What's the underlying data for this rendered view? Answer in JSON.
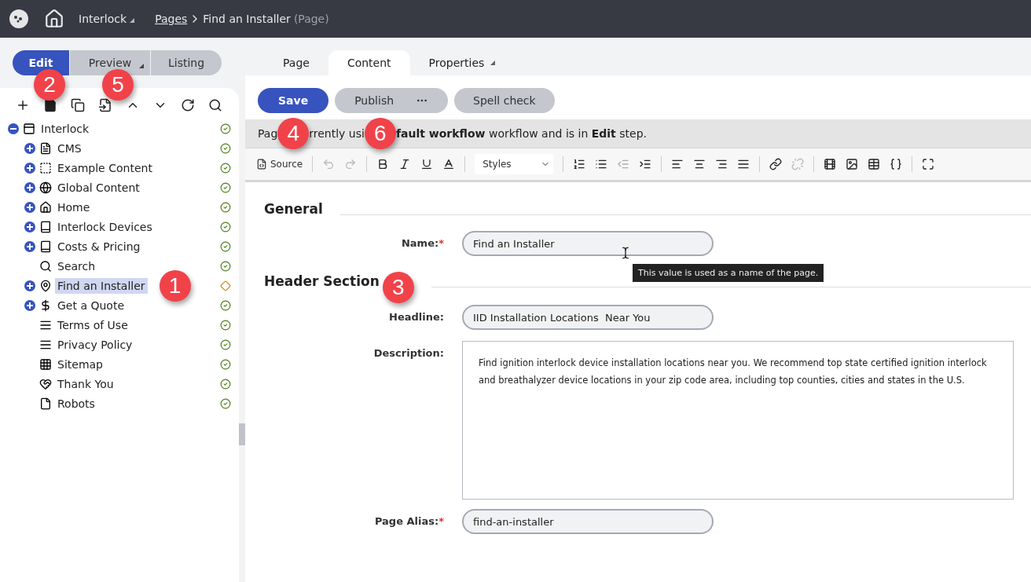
{
  "topbar": {
    "site": "Interlock",
    "crumb_link": "Pages",
    "page": "Find an Installer",
    "page_type": "(Page)"
  },
  "modes": [
    {
      "label": "Edit",
      "selected": true,
      "dropdown": false
    },
    {
      "label": "Preview",
      "selected": false,
      "dropdown": true
    },
    {
      "label": "Listing",
      "selected": false,
      "dropdown": false
    }
  ],
  "tree_toolbar": {
    "callouts": [
      "2",
      "5"
    ]
  },
  "tree": {
    "label": "Interlock",
    "expandable": true,
    "expanded": true,
    "published": true,
    "selected": false,
    "children": [
      {
        "label": "CMS",
        "expandable": true,
        "expanded": false,
        "published": true,
        "selected": false
      },
      {
        "label": "Example Content",
        "expandable": true,
        "expanded": false,
        "published": true,
        "selected": false
      },
      {
        "label": "Global Content",
        "expandable": true,
        "expanded": false,
        "published": true,
        "selected": false
      },
      {
        "label": "Home",
        "expandable": true,
        "expanded": false,
        "published": true,
        "selected": false
      },
      {
        "label": "Interlock Devices",
        "expandable": true,
        "expanded": false,
        "published": true,
        "selected": false
      },
      {
        "label": "Costs & Pricing",
        "expandable": true,
        "expanded": false,
        "published": true,
        "selected": false
      },
      {
        "label": "Search",
        "expandable": false,
        "published": true,
        "selected": false
      },
      {
        "label": "Find an Installer",
        "expandable": true,
        "expanded": false,
        "published": false,
        "selected": true,
        "callout": "1"
      },
      {
        "label": "Get a Quote",
        "expandable": true,
        "expanded": false,
        "published": true,
        "selected": false
      },
      {
        "label": "Terms of Use",
        "expandable": false,
        "published": true,
        "selected": false
      },
      {
        "label": "Privacy Policy",
        "expandable": false,
        "published": true,
        "selected": false
      },
      {
        "label": "Sitemap",
        "expandable": false,
        "published": true,
        "selected": false
      },
      {
        "label": "Thank You",
        "expandable": false,
        "published": true,
        "selected": false
      },
      {
        "label": "Robots",
        "expandable": false,
        "published": true,
        "selected": false
      }
    ]
  },
  "tabs": [
    {
      "label": "Page",
      "selected": false,
      "dropdown": false
    },
    {
      "label": "Content",
      "selected": true,
      "dropdown": false
    },
    {
      "label": "Properties",
      "selected": false,
      "dropdown": true
    }
  ],
  "actions": {
    "save": "Save",
    "publish": "Publish",
    "spell_check": "Spell check"
  },
  "workflow": {
    "parts": [
      "Pag",
      "rrently usi",
      "**fault workflow** workflow and is in **Edit** step."
    ],
    "callouts": [
      "4",
      "6"
    ]
  },
  "editor_toolbar": {
    "source": "Source",
    "styles": "Styles"
  },
  "sections": [
    {
      "title": "General",
      "fields": [
        {
          "label": "Name:",
          "required_mark": "*",
          "kind": "input",
          "value": "Find an Installer",
          "tooltip": "This value is used as a name of the page."
        }
      ]
    },
    {
      "title": "Header Section",
      "callout": "3",
      "fields": [
        {
          "label": "Headline:",
          "kind": "input",
          "value": "IID Installation Locations  Near You"
        },
        {
          "label": "Description:",
          "kind": "textarea",
          "value": "Find ignition interlock device installation locations near you. We recommend top state certified ignition interlock and breathalyzer device locations in your zip code area, including top counties, cities and states in the U.S."
        },
        {
          "label": "Page Alias:",
          "required_mark": "*",
          "kind": "input",
          "value": "find-an-installer"
        }
      ]
    }
  ]
}
